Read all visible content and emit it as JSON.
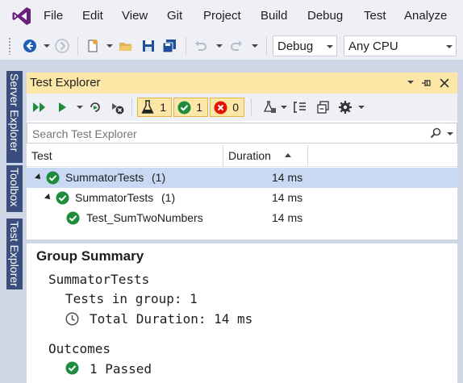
{
  "menu": {
    "items": [
      "File",
      "Edit",
      "View",
      "Git",
      "Project",
      "Build",
      "Debug",
      "Test",
      "Analyze"
    ]
  },
  "toolbar": {
    "config_value": "Debug",
    "platform_value": "Any CPU"
  },
  "side_tabs": [
    "Server Explorer",
    "Toolbox",
    "Test Explorer"
  ],
  "panel": {
    "title": "Test Explorer",
    "counts": {
      "total": "1",
      "passed": "1",
      "failed": "0"
    },
    "search_placeholder": "Search Test Explorer",
    "columns": {
      "test": "Test",
      "duration": "Duration"
    }
  },
  "rows": [
    {
      "name": "SummatorTests",
      "count": "(1)",
      "duration": "14 ms"
    },
    {
      "name": "SummatorTests",
      "count": "(1)",
      "duration": "14 ms"
    },
    {
      "name": "Test_SumTwoNumbers",
      "count": "",
      "duration": "14 ms"
    }
  ],
  "summary": {
    "heading": "Group Summary",
    "group_name": "SummatorTests",
    "tests_in_group": "Tests in group: 1",
    "total_duration": "Total Duration: 14 ms",
    "outcomes_label": "Outcomes",
    "passed": "1 Passed"
  },
  "colors": {
    "accent": "#68217a",
    "title_bar": "#fde7a6",
    "selected_row": "#c9d9f3",
    "passed": "#1e8c3a",
    "failed": "#e51400",
    "side_tab": "#3a4e7e"
  }
}
